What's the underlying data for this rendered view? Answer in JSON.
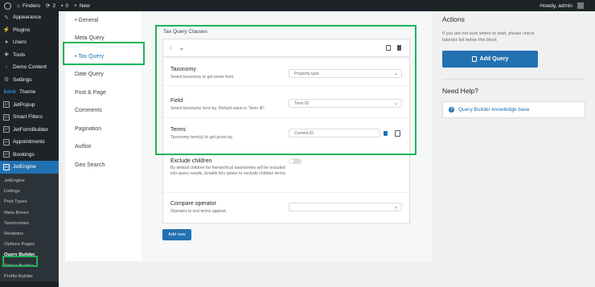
{
  "admin_bar": {
    "site_name": "Findero",
    "updates_count": "2",
    "comments_count": "0",
    "new_label": "New",
    "greeting": "Howdy, admin"
  },
  "wp_menu": {
    "items": [
      {
        "label": "Appearance",
        "icon": "brush-icon"
      },
      {
        "label": "Plugins",
        "icon": "plug-icon"
      },
      {
        "label": "Users",
        "icon": "user-icon"
      },
      {
        "label": "Tools",
        "icon": "wrench-icon"
      },
      {
        "label": "Demo Content",
        "icon": "download-icon"
      },
      {
        "label": "Settings",
        "icon": "settings-icon"
      },
      {
        "label": "Theme",
        "icon": "kava-logo-icon",
        "logo_text": "kava"
      },
      {
        "label": "JetPopup",
        "icon": "jet-icon"
      },
      {
        "label": "Smart Filters",
        "icon": "jet-icon"
      },
      {
        "label": "JetFormBuilder",
        "icon": "jet-icon"
      },
      {
        "label": "Appointments",
        "icon": "jet-icon"
      },
      {
        "label": "Bookings",
        "icon": "jet-icon"
      },
      {
        "label": "JetEngine",
        "icon": "jet-icon",
        "active": true
      }
    ],
    "jet_icon_text": "JET",
    "submenu": [
      "JetEngine",
      "Listings",
      "Post Types",
      "Meta Boxes",
      "Taxonomies",
      "Relations",
      "Options Pages",
      "Query Builder",
      "Tables Builder",
      "Profile Builder"
    ]
  },
  "query_tabs": [
    "• General",
    "Meta Query",
    "• Tax Query",
    "Date Query",
    "Post & Page",
    "Comments",
    "Pagination",
    "Author",
    "Geo Search"
  ],
  "tax_query": {
    "section_title": "Tax Query Clauses",
    "taxonomy": {
      "label": "Taxonomy",
      "desc": "Select taxonomy to get posts from",
      "value": "Property type"
    },
    "field": {
      "label": "Field",
      "desc": "Select taxonomy term by. Default value is 'Term ID'.",
      "value": "Term ID"
    },
    "terms": {
      "label": "Terms",
      "desc": "Taxonomy term(s) to get posts by.",
      "placeholder": "Current ID"
    },
    "exclude_children": {
      "label": "Exclude children",
      "desc": "By default children for hierarchical taxonomies will be included into query results. Enable this option to exclude children terms.",
      "enabled": false
    },
    "compare_operator": {
      "label": "Compare operator",
      "desc": "Operator to test terms against.",
      "value": ""
    },
    "add_new_label": "Add new"
  },
  "sidebar": {
    "actions_title": "Actions",
    "actions_text": "If you are not sure where to start, please check tutorials list below this block",
    "add_query_label": "Add Query",
    "help_title": "Need Help?",
    "help_link": "Query Builder knowledge base"
  },
  "colors": {
    "accent": "#2271b1",
    "highlight": "#1fb35b",
    "admin_dark": "#1d2327"
  }
}
